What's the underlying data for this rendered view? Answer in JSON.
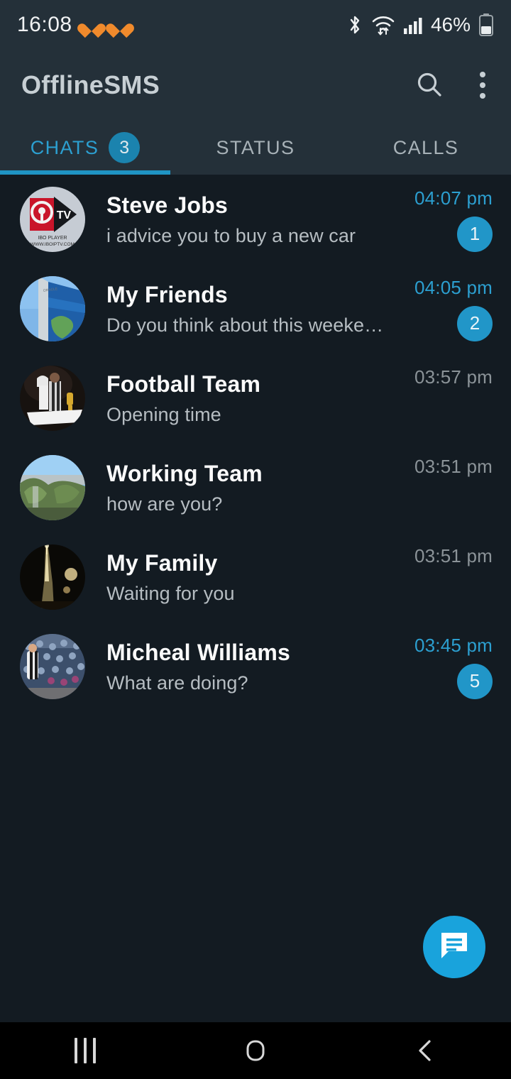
{
  "status_bar": {
    "time": "16:08",
    "notification_icons": [
      "heart-icon",
      "heart-icon"
    ],
    "system_icons": [
      "bluetooth-icon",
      "wifi-icon",
      "cellular-signal-icon"
    ],
    "battery_percent": "46%",
    "colors": {
      "notification_accent": "#f08a2c",
      "background": "#243039",
      "text": "#f0f2f3"
    }
  },
  "app_bar": {
    "title": "OfflineSMS",
    "search_icon": "search-icon",
    "overflow_icon": "overflow-menu-icon",
    "background": "#243039"
  },
  "tabs": {
    "items": [
      {
        "label": "CHATS",
        "badge": "3",
        "active": true
      },
      {
        "label": "STATUS",
        "badge": "",
        "active": false
      },
      {
        "label": "CALLS",
        "badge": "",
        "active": false
      }
    ],
    "indicator_color": "#1f94c4",
    "active_color": "#2c9fd0",
    "inactive_color": "#a8b2b8"
  },
  "chats": [
    {
      "name": "Steve Jobs",
      "message": "i advice you to buy a new car",
      "time": "04:07 pm",
      "unread": "1",
      "avatar": "ibo-player-tv-logo-avatar"
    },
    {
      "name": "My Friends",
      "message": "Do you think about this weekend?",
      "time": "04:05 pm",
      "unread": "2",
      "avatar": "building-sky-photo-avatar"
    },
    {
      "name": "Football Team",
      "message": "Opening time",
      "time": "03:57 pm",
      "unread": "",
      "avatar": "trophy-ceremony-photo-avatar"
    },
    {
      "name": "Working Team",
      "message": "how are you?",
      "time": "03:51 pm",
      "unread": "",
      "avatar": "trees-landscape-photo-avatar"
    },
    {
      "name": "My Family",
      "message": "Waiting for you",
      "time": "03:51 pm",
      "unread": "",
      "avatar": "night-tower-photo-avatar"
    },
    {
      "name": "Micheal Williams",
      "message": "What are doing?",
      "time": "03:45 pm",
      "unread": "5",
      "avatar": "stadium-crowd-photo-avatar"
    }
  ],
  "fab": {
    "icon": "new-message-icon",
    "color": "#19a3dc"
  },
  "nav_bar": {
    "recents_icon": "recents-icon",
    "home_icon": "home-icon",
    "back_icon": "back-icon"
  },
  "theme": {
    "list_background": "#131b22",
    "bar_background": "#243039",
    "accent": "#2196c8",
    "primary_text": "#fafafa",
    "secondary_text": "#b6bdc2"
  }
}
